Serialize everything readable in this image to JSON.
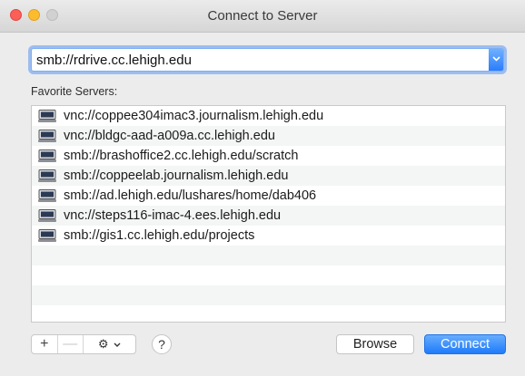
{
  "window": {
    "title": "Connect to Server"
  },
  "address": {
    "value": "smb://rdrive.cc.lehigh.edu"
  },
  "favorites": {
    "label": "Favorite Servers:",
    "items": [
      {
        "label": "vnc://coppee304imac3.journalism.lehigh.edu",
        "icon": "server-icon"
      },
      {
        "label": "vnc://bldgc-aad-a009a.cc.lehigh.edu",
        "icon": "server-icon"
      },
      {
        "label": "smb://brashoffice2.cc.lehigh.edu/scratch",
        "icon": "server-icon"
      },
      {
        "label": "smb://coppeelab.journalism.lehigh.edu",
        "icon": "server-icon"
      },
      {
        "label": "smb://ad.lehigh.edu/lushares/home/dab406",
        "icon": "server-icon"
      },
      {
        "label": "vnc://steps116-imac-4.ees.lehigh.edu",
        "icon": "server-icon"
      },
      {
        "label": "smb://gis1.cc.lehigh.edu/projects",
        "icon": "server-icon"
      }
    ]
  },
  "toolbar": {
    "add_label": "+",
    "remove_label": "—",
    "help_label": "?",
    "browse_label": "Browse",
    "connect_label": "Connect"
  },
  "colors": {
    "accent": "#2a7dfb",
    "close": "#fc5f57",
    "minimize": "#fdbc2e"
  }
}
